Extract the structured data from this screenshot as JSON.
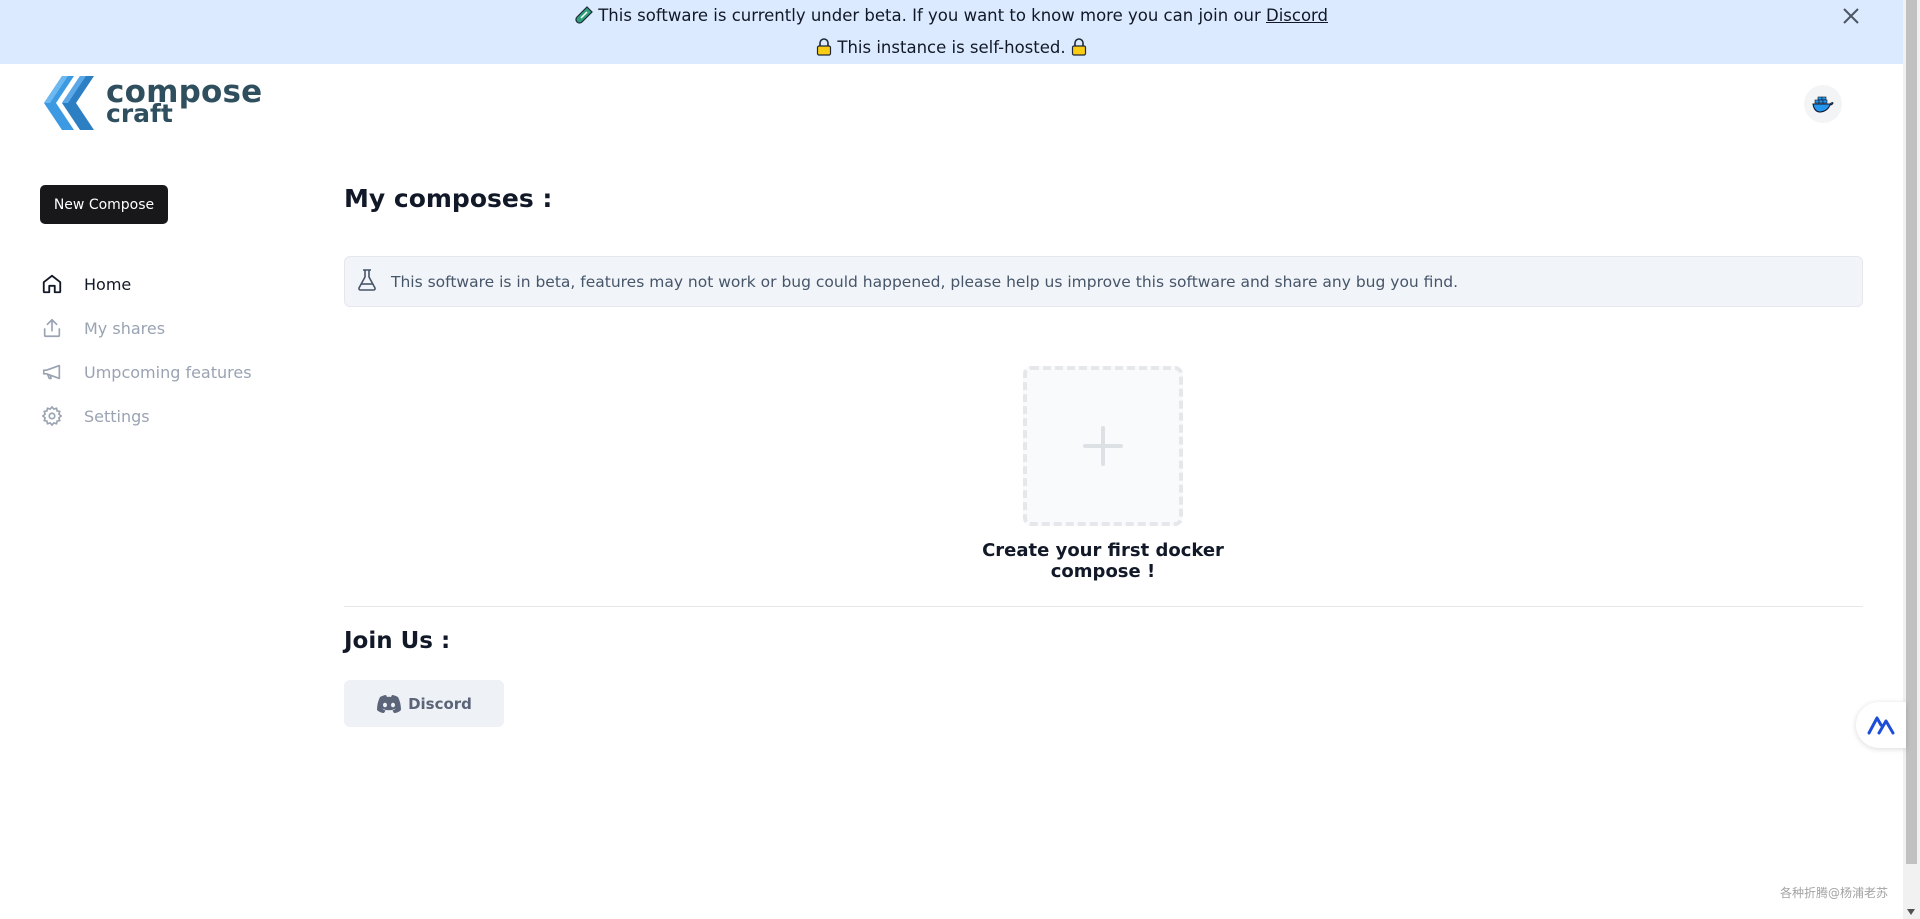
{
  "banner": {
    "line1_prefix": "This software is currently under beta. If you want to know more you can join our",
    "line1_link": "Discord",
    "line2": "This instance is self-hosted."
  },
  "logo": {
    "line1": "compose",
    "line2": "craft"
  },
  "sidebar": {
    "new_button": "New Compose",
    "items": [
      {
        "label": "Home",
        "icon": "home-icon",
        "active": true
      },
      {
        "label": "My shares",
        "icon": "share-icon",
        "active": false
      },
      {
        "label": "Umpcoming features",
        "icon": "megaphone-icon",
        "active": false
      },
      {
        "label": "Settings",
        "icon": "gear-icon",
        "active": false
      }
    ]
  },
  "main": {
    "title": "My composes :",
    "alert_text": "This software is in beta, features may not work or bug could happened, please help us improve this software and share any bug you find.",
    "create_label": "Create your first docker compose !",
    "join_title": "Join Us :",
    "discord_button": "Discord"
  },
  "watermark": "各种折腾@杨浦老苏",
  "colors": {
    "banner_bg": "#dbeafe",
    "primary_button": "#18181b",
    "logo_text": "#2f4f5f",
    "logo_blue": "#3b9ae1"
  }
}
